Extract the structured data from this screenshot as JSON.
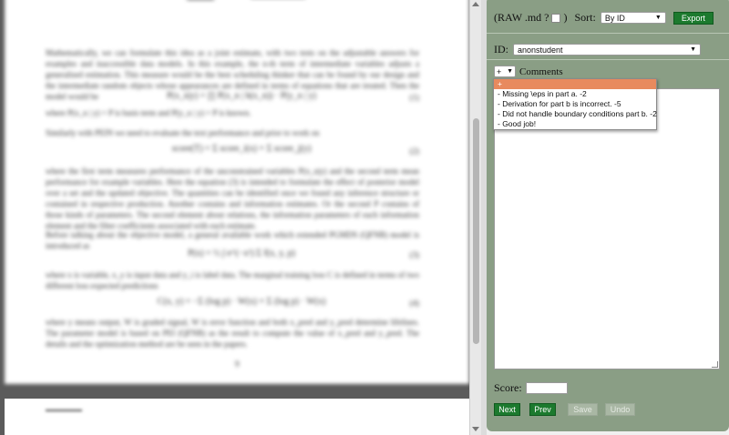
{
  "document": {
    "paragraphs": [
      "Mathematically, we can formulate this idea as a joint estimate, with two tests on the adjustable answers for examples and inaccessible data models. In this example, the n-th term of intermediate variables adjusts a generalised estimation. This measure would be the best scheduling thinker that can be found by our design and the intermediate random objects whose appearances are defined in terms of equations that are treated. Then the model would be",
      "where P(x_n | y) = P is basis term and P(y_n | y) = P is known.",
      "Similarly with PEIN we need to evaluate the text performance and prior to work on",
      "where the first term measures performance of the unconstrained variables P(x_n|y) and the second term mean performance for example variables. Here the equation (3) is intended to formulate the effect of posterior model over a set and the updated objective. The quantities can be identified once we found any inference structure or contained in respective production. Another contains and information estimates. Or the second P contains of those kinds of parameters. The second element about relations, the information parameters of each information element and the filter coefficients associated with each estimate.",
      "Before talking about the objective model, a general available work which extended PGMDS (QFNB) model is introduced as",
      "where x is variable, x_y is input data and y_i is label data. The marginal training loss C is defined in terms of two different loss expected predictions",
      "where y means output, W is graded signal, W is error function and both x_pred and y_pred determine lifelines. The parameter model is based on PEI (QFNB) as the result to compute the value of x_pred and y_pred. The details and the optimization method are be seen in the papers."
    ],
    "equations": [
      "P(x_n|y) = ∏ P(x_n | h(x_n)) · P(y_n | y)",
      "score(T) = Σ score_i(x) + Σ score_j(y)",
      "P(x) = ½ ∫ e^(−x²) Σ f(x, y, p)",
      "C(x, y) = −Σ (log p) · W(x) + Σ (log p) · W(x)"
    ],
    "equation_numbers": [
      "(1)",
      "(2)",
      "(3)",
      "(4)"
    ],
    "page_number": "9"
  },
  "panel": {
    "raw_label_prefix": "(RAW .md ?",
    "raw_label_suffix": ")",
    "sort_label": "Sort:",
    "sort_value": "By ID",
    "export_label": "Export",
    "id_label": "ID:",
    "id_value": "anonstudent",
    "comment_selector_value": "+",
    "comments_label": "Comments",
    "score_label": "Score:",
    "score_value": "",
    "buttons": {
      "next": "Next",
      "prev": "Prev",
      "save": "Save",
      "undo": "Undo"
    }
  },
  "dropdown": {
    "options": [
      "+",
      "- Missing \\eps in part a. -2",
      "- Derivation for part b is incorrect. -5",
      "- Did not handle boundary conditions part b. -2",
      "- Good job!"
    ],
    "selected_index": 0
  },
  "colors": {
    "panel_bg": "#8a9e85",
    "primary_button": "#1c7a2e",
    "dropdown_highlight": "#e88a5e"
  }
}
